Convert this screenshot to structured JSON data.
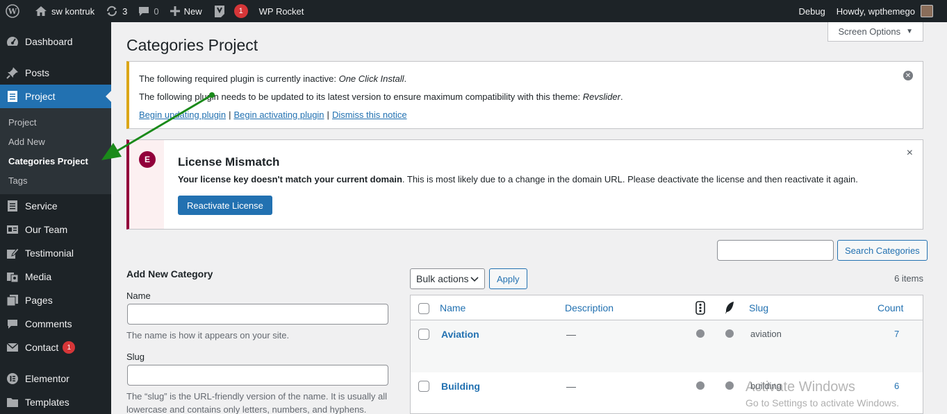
{
  "adminbar": {
    "site_name": "sw kontruk",
    "updates_count": "3",
    "comments_count": "0",
    "new_label": "New",
    "yoast_badge": "1",
    "rocket_label": "WP Rocket",
    "debug_label": "Debug",
    "howdy": "Howdy, wpthemego"
  },
  "menu": {
    "dashboard": "Dashboard",
    "posts": "Posts",
    "project": "Project",
    "sub_project": "Project",
    "sub_add_new": "Add New",
    "sub_categories": "Categories Project",
    "sub_tags": "Tags",
    "service": "Service",
    "our_team": "Our Team",
    "testimonial": "Testimonial",
    "media": "Media",
    "pages": "Pages",
    "comments": "Comments",
    "contact": "Contact",
    "contact_badge": "1",
    "elementor": "Elementor",
    "templates": "Templates"
  },
  "screen_options": "Screen Options",
  "page_title": "Categories Project",
  "notice_tgm": {
    "line1_prefix": "The following required plugin is currently inactive: ",
    "line1_plugin": "One Click Install",
    "line1_suffix": ".",
    "line2_prefix": "The following plugin needs to be updated to its latest version to ensure maximum compatibility with this theme: ",
    "line2_plugin": "Revslider",
    "line2_suffix": ".",
    "link_update": "Begin updating plugin",
    "link_activate": "Begin activating plugin",
    "link_dismiss": "Dismiss this notice",
    "separator": "|"
  },
  "notice_elementor": {
    "logo": "E",
    "title": "License Mismatch",
    "msg_bold": "Your license key doesn't match your current domain",
    "msg_rest": ". This is most likely due to a change in the domain URL. Please deactivate the license and then reactivate it again.",
    "button": "Reactivate License",
    "close": "×"
  },
  "search": {
    "value": "",
    "button": "Search Categories"
  },
  "add_form": {
    "heading": "Add New Category",
    "name_label": "Name",
    "name_value": "",
    "name_desc": "The name is how it appears on your site.",
    "slug_label": "Slug",
    "slug_value": "",
    "slug_desc_1": "The “slug” is the URL-friendly version of the name. It is usually all",
    "slug_desc_2": "lowercase and contains only letters, numbers, and hyphens."
  },
  "list": {
    "bulk_actions": "Bulk actions",
    "apply": "Apply",
    "items_count": "6 items",
    "columns": {
      "name": "Name",
      "description": "Description",
      "slug": "Slug",
      "count": "Count"
    },
    "rows": [
      {
        "name": "Aviation",
        "description": "—",
        "slug": "aviation",
        "count": "7"
      },
      {
        "name": "Building",
        "description": "—",
        "slug": "building",
        "count": "6"
      }
    ]
  },
  "watermark": {
    "line1": "Activate Windows",
    "line2": "Go to Settings to activate Windows."
  },
  "colors": {
    "accent": "#2271b1",
    "adminbar": "#1d2327",
    "warning": "#dba617",
    "elementor": "#92003b",
    "arrow": "#1a8a1a"
  }
}
